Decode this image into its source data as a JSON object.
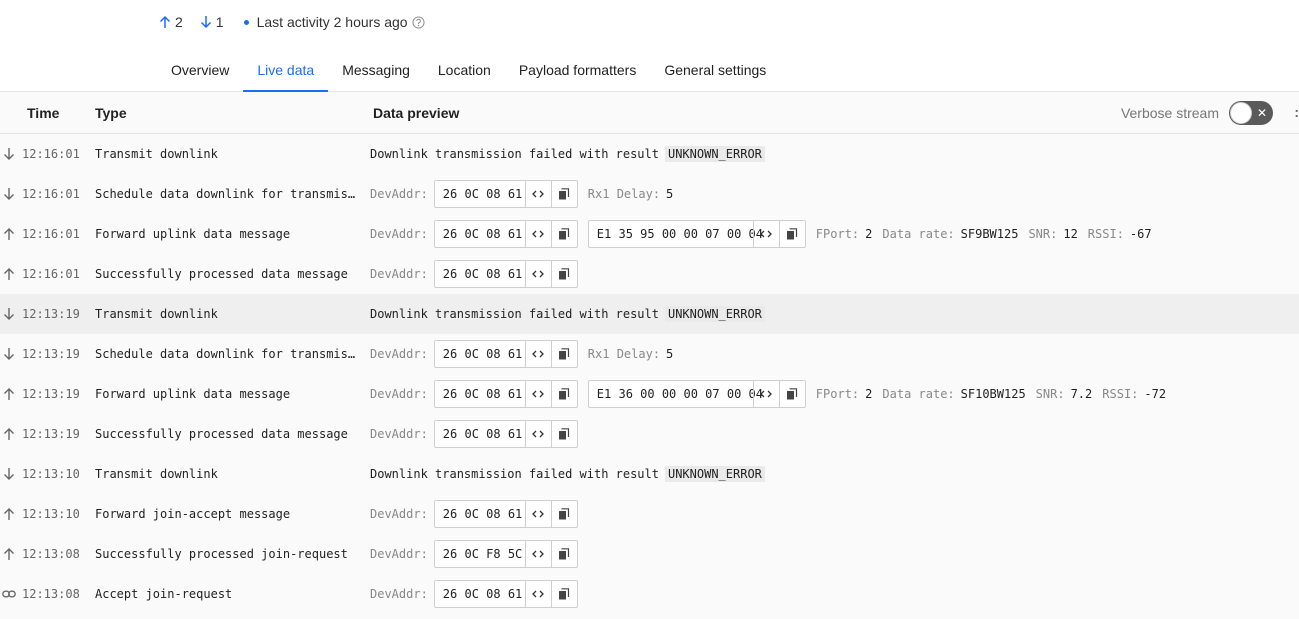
{
  "header": {
    "uplink_count": "2",
    "downlink_count": "1",
    "last_activity": "Last activity 2 hours ago"
  },
  "tabs": [
    {
      "label": "Overview"
    },
    {
      "label": "Live data"
    },
    {
      "label": "Messaging"
    },
    {
      "label": "Location"
    },
    {
      "label": "Payload formatters"
    },
    {
      "label": "General settings"
    }
  ],
  "active_tab": "Live data",
  "table": {
    "columns": {
      "time": "Time",
      "type": "Type",
      "preview": "Data preview"
    },
    "verbose_label": "Verbose stream",
    "verbose_on": false
  },
  "labels": {
    "devaddr": "DevAddr:",
    "rx1": "Rx1 Delay:",
    "fport": "FPort:",
    "datarate": "Data rate:",
    "snr": "SNR:",
    "rssi": "RSSI:",
    "failed": "Downlink transmission failed with result",
    "error": "UNKNOWN_ERROR"
  },
  "rows": [
    {
      "dir": "down",
      "time": "12:16:01",
      "type": "Transmit downlink"
    },
    {
      "dir": "down",
      "time": "12:16:01",
      "type": "Schedule data downlink for transmission",
      "devaddr": "26 0C 08 61",
      "rx1": "5"
    },
    {
      "dir": "up",
      "time": "12:16:01",
      "type": "Forward uplink data message",
      "devaddr": "26 0C 08 61",
      "payload": "E1 35 95 00 00 07 00 04",
      "fport": "2",
      "datarate": "SF9BW125",
      "snr": "12",
      "rssi": "-67"
    },
    {
      "dir": "up",
      "time": "12:16:01",
      "type": "Successfully processed data message",
      "devaddr": "26 0C 08 61"
    },
    {
      "dir": "down",
      "time": "12:13:19",
      "type": "Transmit downlink"
    },
    {
      "dir": "down",
      "time": "12:13:19",
      "type": "Schedule data downlink for transmission",
      "devaddr": "26 0C 08 61",
      "rx1": "5"
    },
    {
      "dir": "up",
      "time": "12:13:19",
      "type": "Forward uplink data message",
      "devaddr": "26 0C 08 61",
      "payload": "E1 36 00 00 00 07 00 04",
      "fport": "2",
      "datarate": "SF10BW125",
      "snr": "7.2",
      "rssi": "-72"
    },
    {
      "dir": "up",
      "time": "12:13:19",
      "type": "Successfully processed data message",
      "devaddr": "26 0C 08 61"
    },
    {
      "dir": "down",
      "time": "12:13:10",
      "type": "Transmit downlink"
    },
    {
      "dir": "up",
      "time": "12:13:10",
      "type": "Forward join-accept message",
      "devaddr": "26 0C 08 61"
    },
    {
      "dir": "up",
      "time": "12:13:08",
      "type": "Successfully processed join-request",
      "devaddr": "26 0C F8 5C"
    },
    {
      "dir": "link",
      "time": "12:13:08",
      "type": "Accept join-request",
      "devaddr": "26 0C 08 61"
    }
  ]
}
